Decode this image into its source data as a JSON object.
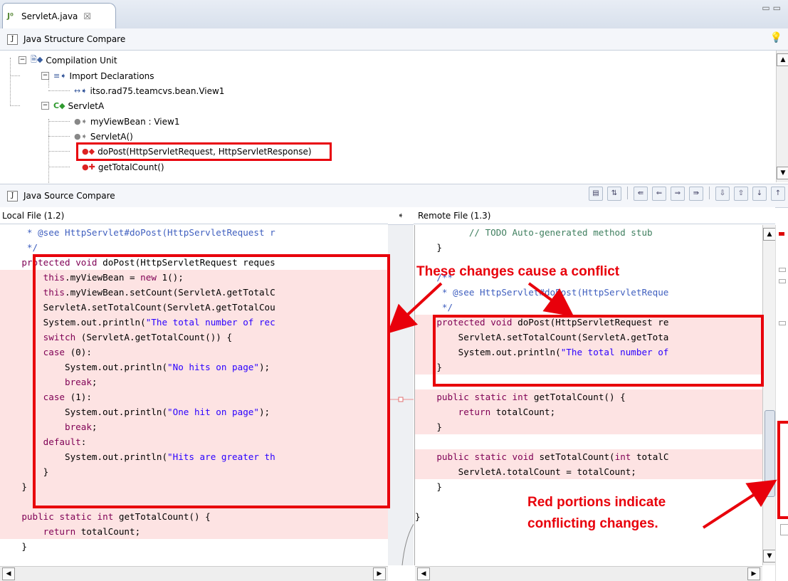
{
  "editor": {
    "tab_label": "ServletA.java",
    "tab_close": "☒"
  },
  "structure": {
    "title": "Java Structure Compare",
    "tree": [
      {
        "label": "Compilation Unit",
        "level": 0
      },
      {
        "label": "Import Declarations",
        "level": 1
      },
      {
        "label": "itso.rad75.teamcvs.bean.View1",
        "level": 2
      },
      {
        "label": "ServletA",
        "level": 1
      },
      {
        "label": "myViewBean : View1",
        "level": 2
      },
      {
        "label": "ServletA()",
        "level": 2
      },
      {
        "label": "doPost(HttpServletRequest, HttpServletResponse)",
        "level": 2
      },
      {
        "label": "getTotalCount()",
        "level": 2
      }
    ]
  },
  "source": {
    "title": "Java Source Compare",
    "left_label": "Local File (1.2)",
    "right_label": "Remote File (1.3)",
    "left_lines": [
      {
        "t": "     * @see HttpServlet#doPost(HttpServletRequest r",
        "c": "jd",
        "hl": false
      },
      {
        "t": "     */",
        "c": "jd",
        "hl": false
      },
      {
        "t": "    protected void doPost(HttpServletRequest reques",
        "c": "",
        "hl": false
      },
      {
        "t": "        this.myViewBean = new View1();",
        "c": "",
        "hl": true
      },
      {
        "t": "        this.myViewBean.setCount(ServletA.getTotalC",
        "c": "",
        "hl": true
      },
      {
        "t": "        ServletA.setTotalCount(ServletA.getTotalCou",
        "c": "",
        "hl": true
      },
      {
        "t": "        System.out.println(\"The total number of rec",
        "c": "",
        "hl": true
      },
      {
        "t": "        switch (ServletA.getTotalCount()) {",
        "c": "",
        "hl": true
      },
      {
        "t": "        case (0):",
        "c": "",
        "hl": true
      },
      {
        "t": "            System.out.println(\"No hits on page\");",
        "c": "",
        "hl": true
      },
      {
        "t": "            break;",
        "c": "",
        "hl": true
      },
      {
        "t": "        case (1):",
        "c": "",
        "hl": true
      },
      {
        "t": "            System.out.println(\"One hit on page\");",
        "c": "",
        "hl": true
      },
      {
        "t": "            break;",
        "c": "",
        "hl": true
      },
      {
        "t": "        default:",
        "c": "",
        "hl": true
      },
      {
        "t": "            System.out.println(\"Hits are greater th",
        "c": "",
        "hl": true
      },
      {
        "t": "        }",
        "c": "",
        "hl": true
      },
      {
        "t": "    }",
        "c": "",
        "hl": true
      },
      {
        "t": "",
        "c": "",
        "hl": true
      },
      {
        "t": "    public static int getTotalCount() {",
        "c": "",
        "hl": true
      },
      {
        "t": "        return totalCount;",
        "c": "",
        "hl": true
      },
      {
        "t": "    }",
        "c": "",
        "hl": false
      }
    ],
    "right_lines": [
      {
        "t": "          // TODO Auto-generated method stub",
        "c": "cmt",
        "hl": false
      },
      {
        "t": "    }",
        "c": "",
        "hl": false
      },
      {
        "t": "",
        "c": "",
        "hl": false
      },
      {
        "t": "    /**",
        "c": "jd",
        "hl": false
      },
      {
        "t": "     * @see HttpServlet#doPost(HttpServletReque",
        "c": "jd",
        "hl": false
      },
      {
        "t": "     */",
        "c": "jd",
        "hl": false
      },
      {
        "t": "    protected void doPost(HttpServletRequest re",
        "c": "",
        "hl": true
      },
      {
        "t": "        ServletA.setTotalCount(ServletA.getTota",
        "c": "",
        "hl": true
      },
      {
        "t": "        System.out.println(\"The total number of",
        "c": "",
        "hl": true
      },
      {
        "t": "    }",
        "c": "",
        "hl": true
      },
      {
        "t": "",
        "c": "",
        "hl": false
      },
      {
        "t": "    public static int getTotalCount() {",
        "c": "",
        "hl": true
      },
      {
        "t": "        return totalCount;",
        "c": "",
        "hl": true
      },
      {
        "t": "    }",
        "c": "",
        "hl": true
      },
      {
        "t": "",
        "c": "",
        "hl": false
      },
      {
        "t": "    public static void setTotalCount(int totalC",
        "c": "",
        "hl": true
      },
      {
        "t": "        ServletA.totalCount = totalCount;",
        "c": "",
        "hl": true
      },
      {
        "t": "    }",
        "c": "",
        "hl": false
      },
      {
        "t": "",
        "c": "",
        "hl": false
      },
      {
        "t": "}",
        "c": "",
        "hl": false
      }
    ]
  },
  "annotations": {
    "conflict": "These changes cause a conflict",
    "red_line1": "Red portions indicate",
    "red_line2": "conflicting changes."
  },
  "colors": {
    "conflict_red": "#e8000b",
    "diff_bg": "#fde3e3",
    "keyword": "#7f0055",
    "string": "#2a00ff"
  }
}
